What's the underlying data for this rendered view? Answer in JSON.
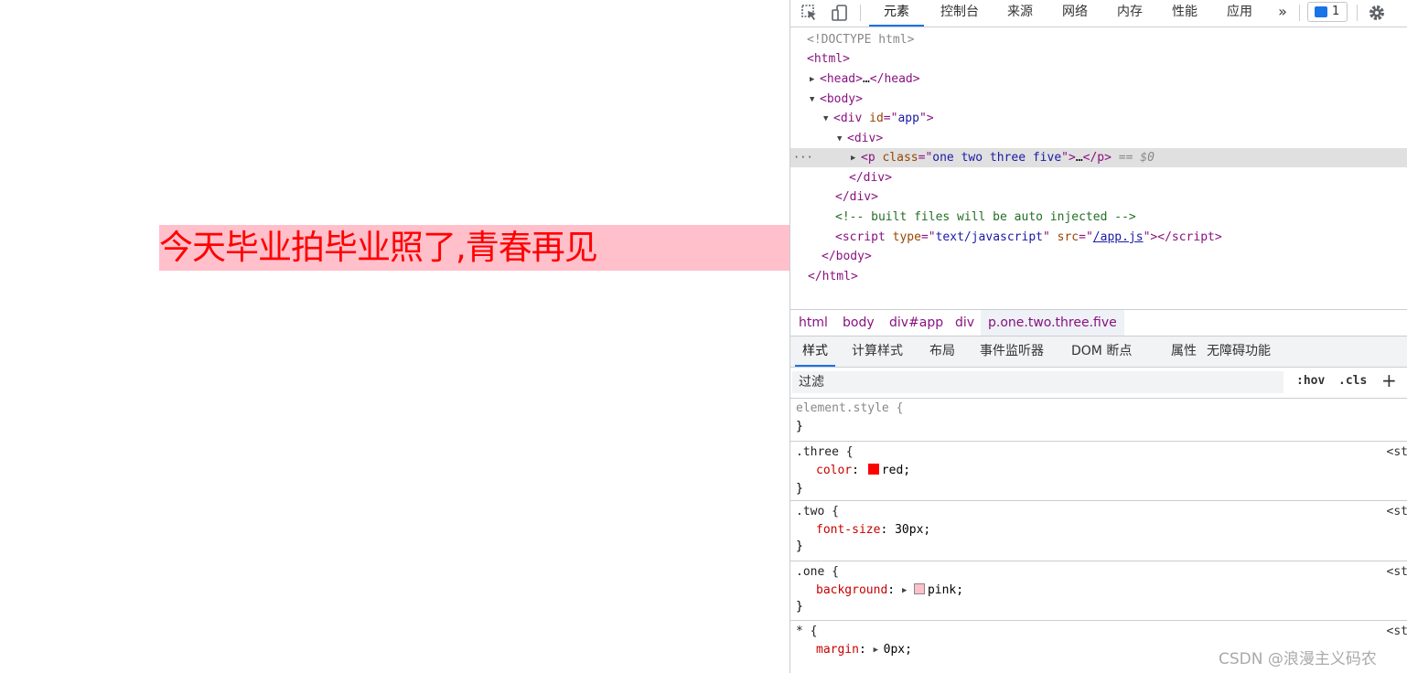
{
  "page": {
    "paragraph_text": "今天毕业拍毕业照了,青春再见",
    "colors": {
      "background": "pink",
      "text": "red"
    }
  },
  "devtools": {
    "toolbar": {
      "icons": [
        "inspect-icon",
        "device-toolbar-icon"
      ],
      "tabs": [
        "元素",
        "控制台",
        "来源",
        "网络",
        "内存",
        "性能",
        "应用"
      ],
      "active_tab": "元素",
      "more_icon": "»",
      "issues_count": "1",
      "settings_icon": "gear-icon"
    },
    "dom": {
      "doctype": "<!DOCTYPE html>",
      "html_open": "html",
      "head": {
        "tag": "head",
        "ellipsis": "…",
        "close": "/head"
      },
      "body": "body",
      "div_app": {
        "tag": "div",
        "attr": "id",
        "value": "app"
      },
      "div_inner": "div",
      "p_selected": {
        "tag": "p",
        "attr": "class",
        "value": "one two three five",
        "ellipsis": "…",
        "close": "/p",
        "marker": "== $0"
      },
      "div_close": "/div",
      "div_close2": "/div",
      "comment": "<!-- built files will be auto injected -->",
      "script": {
        "tag": "script",
        "attr1": "type",
        "val1": "text/javascript",
        "attr2": "src",
        "val2": "/app.js",
        "close": "/script"
      },
      "body_close": "/body",
      "html_close": "/html",
      "dots": "···"
    },
    "breadcrumbs": [
      "html",
      "body",
      "div#app",
      "div",
      "p.one.two.three.five"
    ],
    "styles_tabs": [
      "样式",
      "计算样式",
      "布局",
      "事件监听器",
      "DOM 断点",
      "属性",
      "无障碍功能"
    ],
    "filter": {
      "placeholder": "过滤",
      "hov": ":hov",
      "cls": ".cls",
      "add": "+"
    },
    "rules": [
      {
        "selector": "element.style {",
        "close": "}"
      },
      {
        "selector": ".three {",
        "prop": "color",
        "value": "red;",
        "swatch": "#ff0000",
        "close": "}",
        "source": "<st"
      },
      {
        "selector": ".two {",
        "prop": "font-size",
        "value": "30px;",
        "close": "}",
        "source": "<st"
      },
      {
        "selector": ".one {",
        "prop": "background",
        "value": "pink;",
        "swatch": "#ffc0cb",
        "close": "}",
        "source": "<st"
      },
      {
        "selector": "* {",
        "prop": "margin",
        "value": "0px;",
        "source": "<st"
      }
    ]
  },
  "watermark": "CSDN @浪漫主义码农"
}
